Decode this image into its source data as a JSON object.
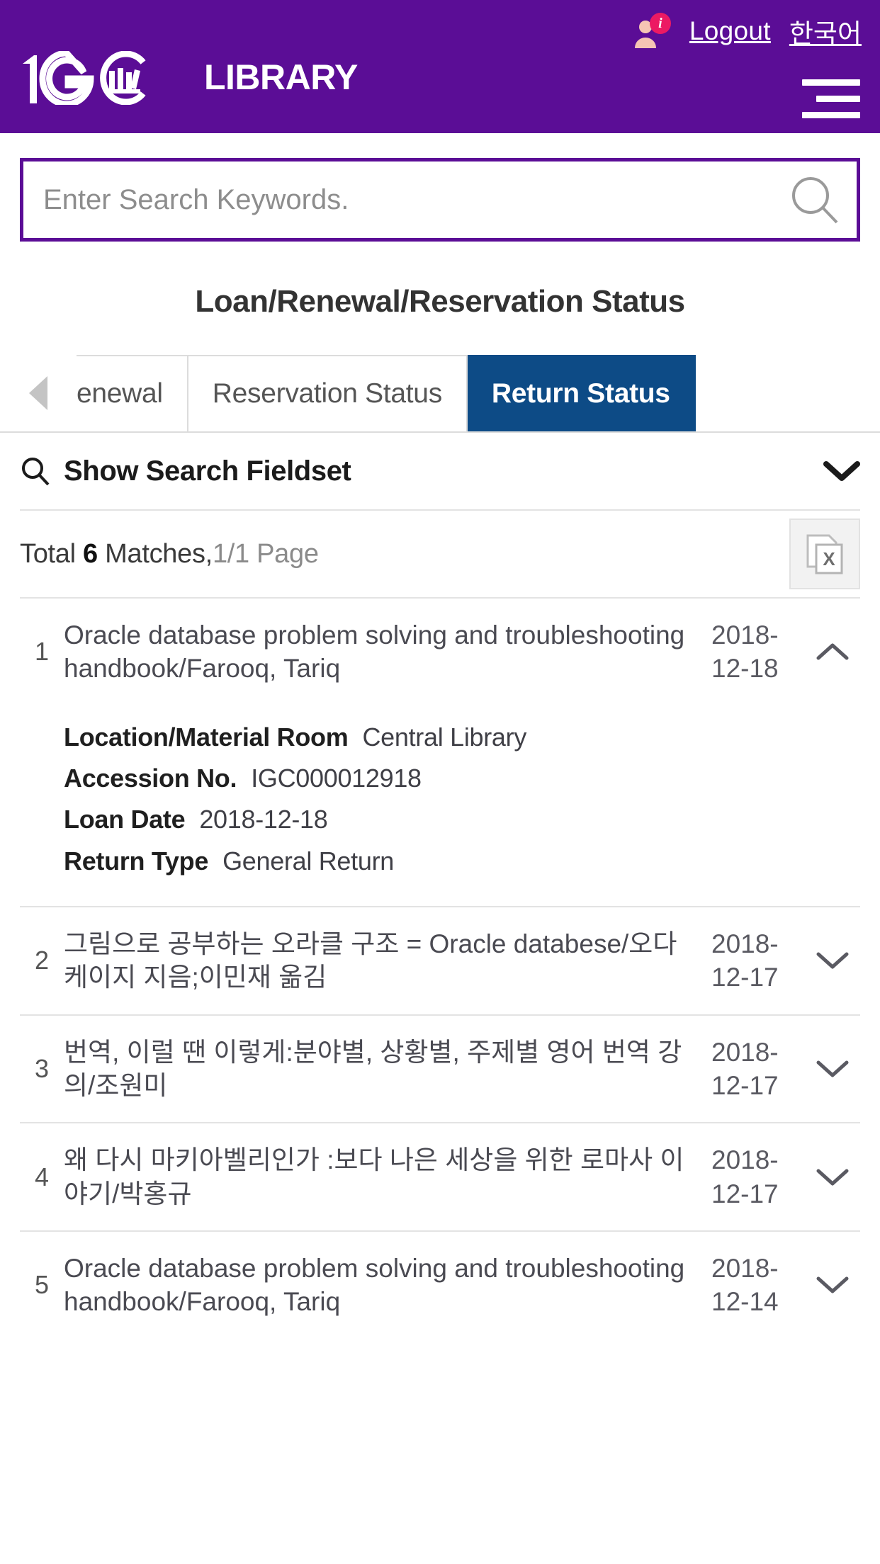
{
  "header": {
    "logo_number": "1G",
    "logo_word": "LIBRARY",
    "logo_icon": "books-in-circle-icon",
    "user_icon": "user-avatar-icon",
    "info_badge": "i",
    "logout_label": "Logout",
    "language_label": "한국어",
    "menu_icon": "hamburger-menu-icon",
    "brand_color": "#5B0D96"
  },
  "search": {
    "placeholder": "Enter Search Keywords.",
    "value": "",
    "submit_icon": "search-icon"
  },
  "page": {
    "title": "Loan/Renewal/Reservation Status"
  },
  "tabs": {
    "scroll_left_icon": "triangle-left-icon",
    "items": [
      {
        "label": "enewal",
        "active": false,
        "clipped": true
      },
      {
        "label": "Reservation Status",
        "active": false,
        "clipped": false
      },
      {
        "label": "Return Status",
        "active": true,
        "clipped": false
      }
    ],
    "active_color": "#0D4B86"
  },
  "fieldset": {
    "label": "Show Search Fieldset",
    "search_icon": "search-icon",
    "chevron_icon": "chevron-down-icon"
  },
  "summary": {
    "total_prefix": "Total",
    "total_count": "6",
    "matches_label": "Matches,",
    "page_label": "1/1 Page",
    "export_icon": "excel-export-icon"
  },
  "results": [
    {
      "index": "1",
      "title": "Oracle database problem solving and troubleshooting handbook/Farooq, Tariq",
      "date": "2018-12-18",
      "expanded": true,
      "toggle_icon": "chevron-up-icon",
      "details": [
        {
          "label": "Location/Material Room",
          "value": "Central Library"
        },
        {
          "label": "Accession No.",
          "value": "IGC000012918"
        },
        {
          "label": "Loan Date",
          "value": "2018-12-18"
        },
        {
          "label": "Return Type",
          "value": "General Return"
        }
      ]
    },
    {
      "index": "2",
      "title": "그림으로 공부하는 오라클 구조 = Oracle databese/오다 케이지 지음;이민재 옮김",
      "date": "2018-12-17",
      "expanded": false,
      "toggle_icon": "chevron-down-icon",
      "details": []
    },
    {
      "index": "3",
      "title": "번역, 이럴 땐 이렇게:분야별, 상황별, 주제별 영어 번역 강의/조원미",
      "date": "2018-12-17",
      "expanded": false,
      "toggle_icon": "chevron-down-icon",
      "details": []
    },
    {
      "index": "4",
      "title": "왜 다시 마키아벨리인가 :보다 나은 세상을 위한 로마사 이야기/박홍규",
      "date": "2018-12-17",
      "expanded": false,
      "toggle_icon": "chevron-down-icon",
      "details": []
    },
    {
      "index": "5",
      "title": "Oracle database problem solving and troubleshooting handbook/Farooq, Tariq",
      "date": "2018-12-14",
      "expanded": false,
      "toggle_icon": "chevron-down-icon",
      "details": []
    }
  ]
}
